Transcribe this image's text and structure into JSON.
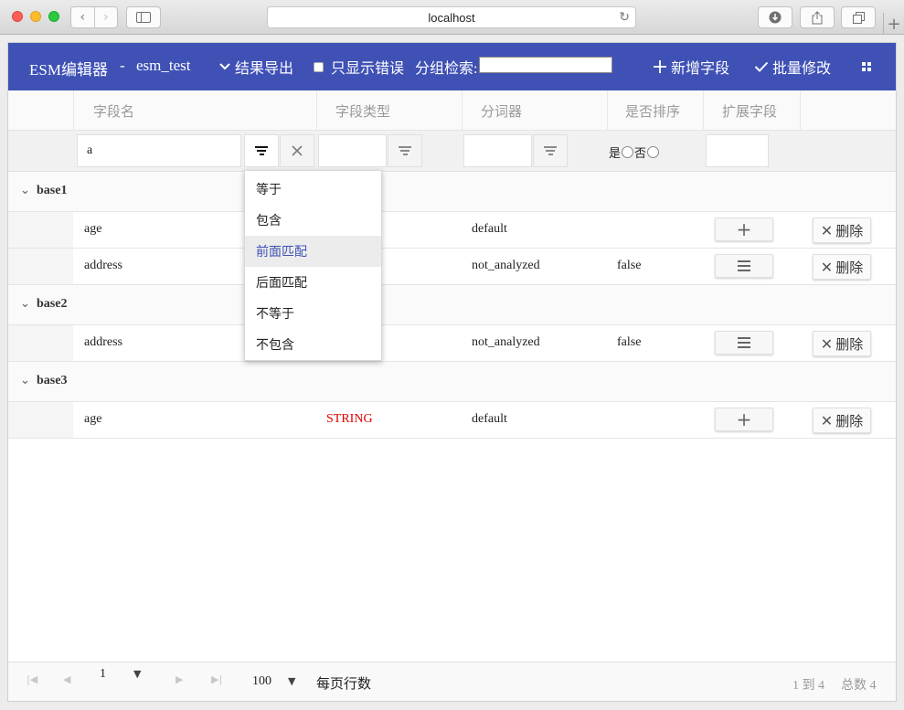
{
  "browser": {
    "url": "localhost",
    "back_icon": "chevron-left-icon",
    "forward_icon": "chevron-right-icon"
  },
  "toolbar": {
    "app_name": "ESM编辑器",
    "separator": "-",
    "db_name": "esm_test",
    "export_label": "结果导出",
    "only_errors_label": "只显示错误",
    "group_search_label": "分组检索:",
    "group_search_value": "",
    "add_field_label": "新增字段",
    "batch_edit_label": "批量修改",
    "accent_color": "#3f51b5"
  },
  "columns": [
    "字段名",
    "字段类型",
    "分词器",
    "是否排序",
    "扩展字段"
  ],
  "filters": {
    "field_name_value": "a",
    "field_type_value": "",
    "analyzer_value": "",
    "sort_yes_label": "是",
    "sort_no_label": "否",
    "ext_value": ""
  },
  "filter_menu": {
    "items": [
      "等于",
      "包含",
      "前面匹配",
      "后面匹配",
      "不等于",
      "不包含"
    ],
    "highlighted_index": 2
  },
  "groups": [
    {
      "name": "base1",
      "rows": [
        {
          "field": "age",
          "type": "",
          "analyzer": "default",
          "sort": "",
          "action": "plus"
        },
        {
          "field": "address",
          "type": "",
          "analyzer": "not_analyzed",
          "sort": "false",
          "action": "menu"
        }
      ]
    },
    {
      "name": "base2",
      "rows": [
        {
          "field": "address",
          "type": "",
          "analyzer": "not_analyzed",
          "sort": "false",
          "action": "menu"
        }
      ]
    },
    {
      "name": "base3",
      "rows": [
        {
          "field": "age",
          "type": "STRING",
          "analyzer": "default",
          "sort": "",
          "action": "plus"
        }
      ]
    }
  ],
  "delete_label": "删除",
  "footer": {
    "page": "1",
    "rows_per_page": "100",
    "rows_per_page_label": "每页行数",
    "range": "1 到 4",
    "total": "总数 4"
  }
}
